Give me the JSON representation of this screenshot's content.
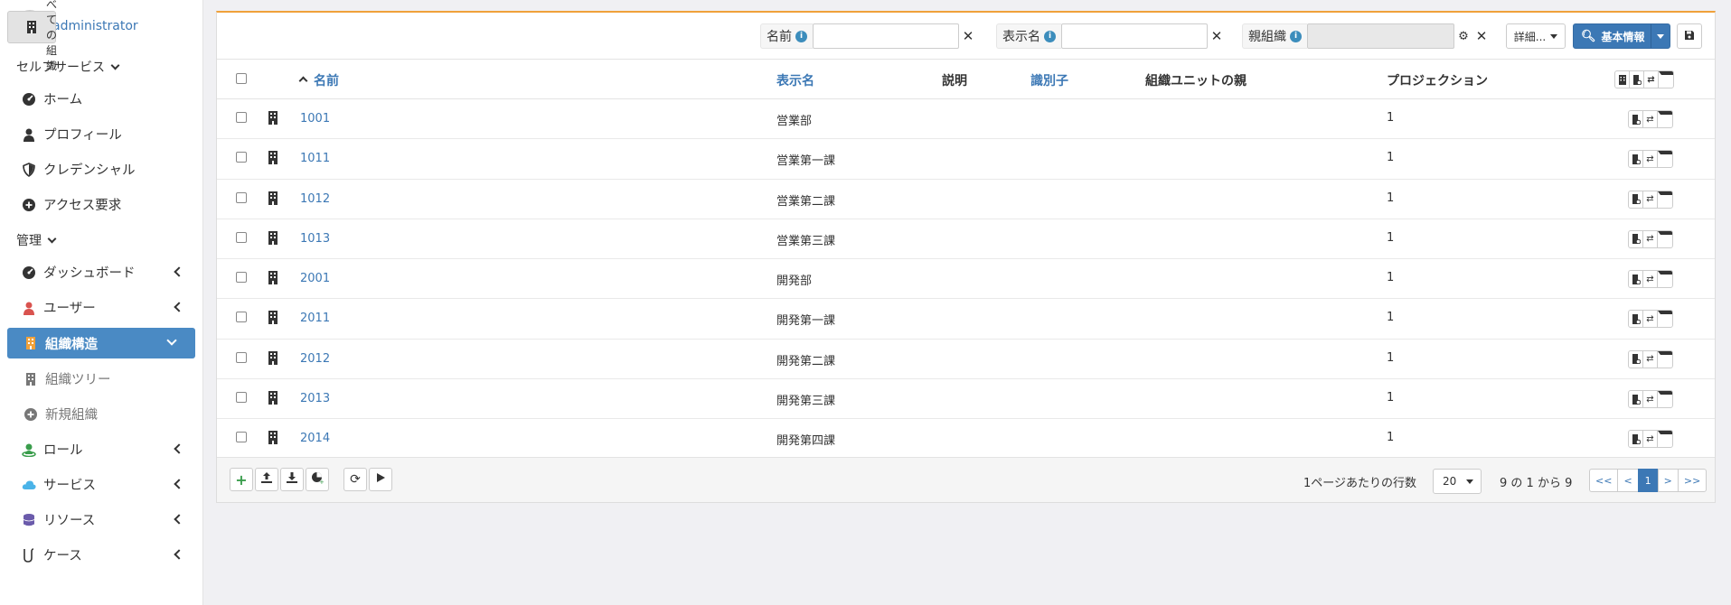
{
  "user": {
    "name": "administrator"
  },
  "sidebar": {
    "self_section": "セルフサービス",
    "self_items": [
      {
        "label": "ホーム",
        "icon": "dashboard-icon"
      },
      {
        "label": "プロフィール",
        "icon": "person-icon"
      },
      {
        "label": "クレデンシャル",
        "icon": "shield-icon"
      },
      {
        "label": "アクセス要求",
        "icon": "plus-circle-icon"
      }
    ],
    "admin_section": "管理",
    "admin_items": [
      {
        "label": "ダッシュボード",
        "icon": "dashboard-icon"
      },
      {
        "label": "ユーザー",
        "icon": "person-icon"
      },
      {
        "label": "組織構造",
        "icon": "building-icon"
      },
      {
        "label": "組織ツリー",
        "icon": "building-icon"
      },
      {
        "label": "すべての組織",
        "icon": "building-icon"
      },
      {
        "label": "新規組織",
        "icon": "plus-circle-icon"
      },
      {
        "label": "ロール",
        "icon": "role-icon"
      },
      {
        "label": "サービス",
        "icon": "cloud-icon"
      },
      {
        "label": "リソース",
        "icon": "database-icon"
      },
      {
        "label": "ケース",
        "icon": "case-icon"
      }
    ]
  },
  "filters": {
    "name_label": "名前",
    "display_label": "表示名",
    "parent_label": "親組織",
    "more_label": "詳細...",
    "basic_label": "基本情報",
    "info_glyph": "i"
  },
  "table": {
    "headers": {
      "name": "名前",
      "display": "表示名",
      "description": "説明",
      "identifier": "識別子",
      "parent_unit": "組織ユニットの親",
      "projection": "プロジェクション"
    },
    "rows": [
      {
        "name": "1001",
        "display": "営業部",
        "projection": "1"
      },
      {
        "name": "1011",
        "display": "営業第一課",
        "projection": "1"
      },
      {
        "name": "1012",
        "display": "営業第二課",
        "projection": "1"
      },
      {
        "name": "1013",
        "display": "営業第三課",
        "projection": "1"
      },
      {
        "name": "2001",
        "display": "開発部",
        "projection": "1"
      },
      {
        "name": "2011",
        "display": "開発第一課",
        "projection": "1"
      },
      {
        "name": "2012",
        "display": "開発第二課",
        "projection": "1"
      },
      {
        "name": "2013",
        "display": "開発第三課",
        "projection": "1"
      },
      {
        "name": "2014",
        "display": "開発第四課",
        "projection": "1"
      }
    ]
  },
  "footer": {
    "rows_per_page_label": "1ページあたりの行数",
    "rows_per_page_value": "20",
    "count_text": "9 の 1 から 9",
    "pager": [
      "<<",
      "<",
      "1",
      ">",
      ">>"
    ]
  },
  "colors": {
    "accent": "#3c78b5",
    "active_nav": "#4a8ac4",
    "panel_top": "#f0a13a"
  }
}
